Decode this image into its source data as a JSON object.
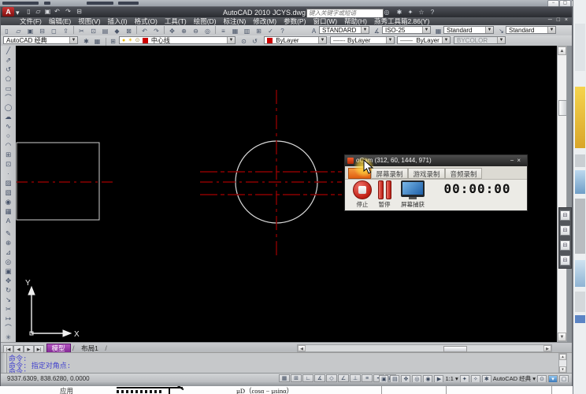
{
  "bg": {
    "top_window_controls": [
      "−",
      "▢",
      "×"
    ],
    "bottom_doc": {
      "app_label": "应用",
      "formula": "µD（cosα − µsinα）"
    }
  },
  "titlebar": {
    "app_title": "AutoCAD 2010",
    "doc_name": "JCYS.dwg",
    "search_placeholder": "键入关键字或短语",
    "logo_letter": "A"
  },
  "menubar": {
    "items": [
      "文件(F)",
      "编辑(E)",
      "视图(V)",
      "插入(I)",
      "格式(O)",
      "工具(T)",
      "绘图(D)",
      "标注(N)",
      "修改(M)",
      "参数(P)",
      "窗口(W)",
      "帮助(H)",
      "燕秀工具箱2.86(Y)"
    ],
    "doc_controls": "─ □ ×"
  },
  "styles_toolbar": {
    "text_style": "STANDARD",
    "dim_style": "ISO-25",
    "table_style": "Standard",
    "mleader_style": "Standard"
  },
  "workspace_toolbar": {
    "workspace": "AutoCAD 经典"
  },
  "layers_toolbar": {
    "layer_name": "中心线"
  },
  "properties_toolbar": {
    "color": "ByLayer",
    "linetype": "ByLayer",
    "lineweight": "ByLayer",
    "plot_style": "BYCOLOR"
  },
  "ucs": {
    "x": "X",
    "y": "Y"
  },
  "ocam": {
    "title": "oCam (312, 60, 1444, 971)",
    "min": "−",
    "close": "×",
    "tabs": [
      "屏幕录制",
      "游戏录制",
      "音频录制"
    ],
    "stop_label": "停止",
    "pause_label": "暂停",
    "capture_label": "屏幕捕获",
    "timer": "00:00:00",
    "accent": "#e8671b"
  },
  "layout_tabs": {
    "model": "模型",
    "layout1": "布局1"
  },
  "command": {
    "lines": [
      "命令:",
      "命令: 指定对角点:",
      "命令:"
    ]
  },
  "statusbar": {
    "coords": "9337.6309, 838.6280, 0.0000",
    "annotation_scale": "1:1",
    "workspace": "AutoCAD 经典"
  },
  "colors": {
    "centerline": "#8b0000",
    "circle_stroke": "#d9d9d9",
    "command_text": "#4343cd",
    "model_tab": "#8b2f9b",
    "layer_color": "#cc0000"
  }
}
